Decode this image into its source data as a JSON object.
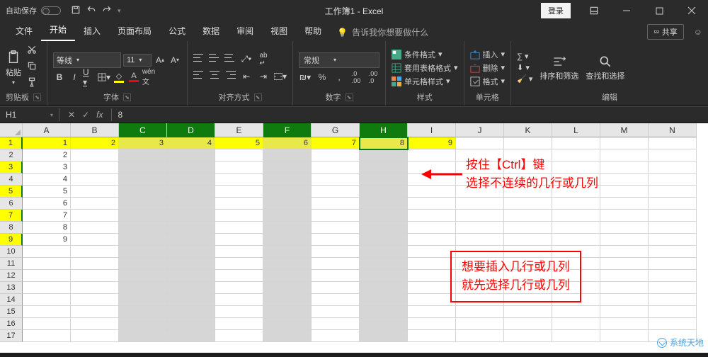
{
  "titlebar": {
    "autosave": "自动保存",
    "title": "工作簿1 - Excel",
    "login": "登录"
  },
  "tabs": {
    "items": [
      "文件",
      "开始",
      "插入",
      "页面布局",
      "公式",
      "数据",
      "审阅",
      "视图",
      "帮助"
    ],
    "tellme": "告诉我你想要做什么",
    "share": "共享"
  },
  "ribbon": {
    "clipboard": {
      "label": "剪贴板",
      "paste": "粘贴"
    },
    "font": {
      "label": "字体",
      "name": "等线",
      "size": "11"
    },
    "align": {
      "label": "对齐方式"
    },
    "number": {
      "label": "数字",
      "format": "常规"
    },
    "styles": {
      "label": "样式",
      "cond": "条件格式",
      "table": "套用表格格式",
      "cell": "单元格样式"
    },
    "cells": {
      "label": "单元格",
      "insert": "插入",
      "delete": "删除",
      "format": "格式"
    },
    "edit": {
      "label": "编辑",
      "sort": "排序和筛选",
      "find": "查找和选择"
    }
  },
  "formula": {
    "name": "H1",
    "value": "8"
  },
  "sheet": {
    "cols": [
      "A",
      "B",
      "C",
      "D",
      "E",
      "F",
      "G",
      "H",
      "I",
      "J",
      "K",
      "L",
      "M",
      "N"
    ],
    "selcols": [
      "C",
      "D",
      "F",
      "H"
    ],
    "row1": [
      1,
      2,
      3,
      4,
      5,
      6,
      7,
      8,
      9
    ],
    "colA_rows2to9": [
      2,
      3,
      4,
      5,
      6,
      7,
      8,
      9
    ],
    "activeCell": "H1",
    "yellowRowHeaders": [
      1,
      3,
      5,
      7,
      9
    ]
  },
  "annotations": {
    "tip1_l1": "按住【Ctrl】键",
    "tip1_l2": "选择不连续的几行或几列",
    "tip2_l1": "想要插入几行或几列",
    "tip2_l2": "就先选择几行或几列"
  },
  "watermark": "系统天地"
}
